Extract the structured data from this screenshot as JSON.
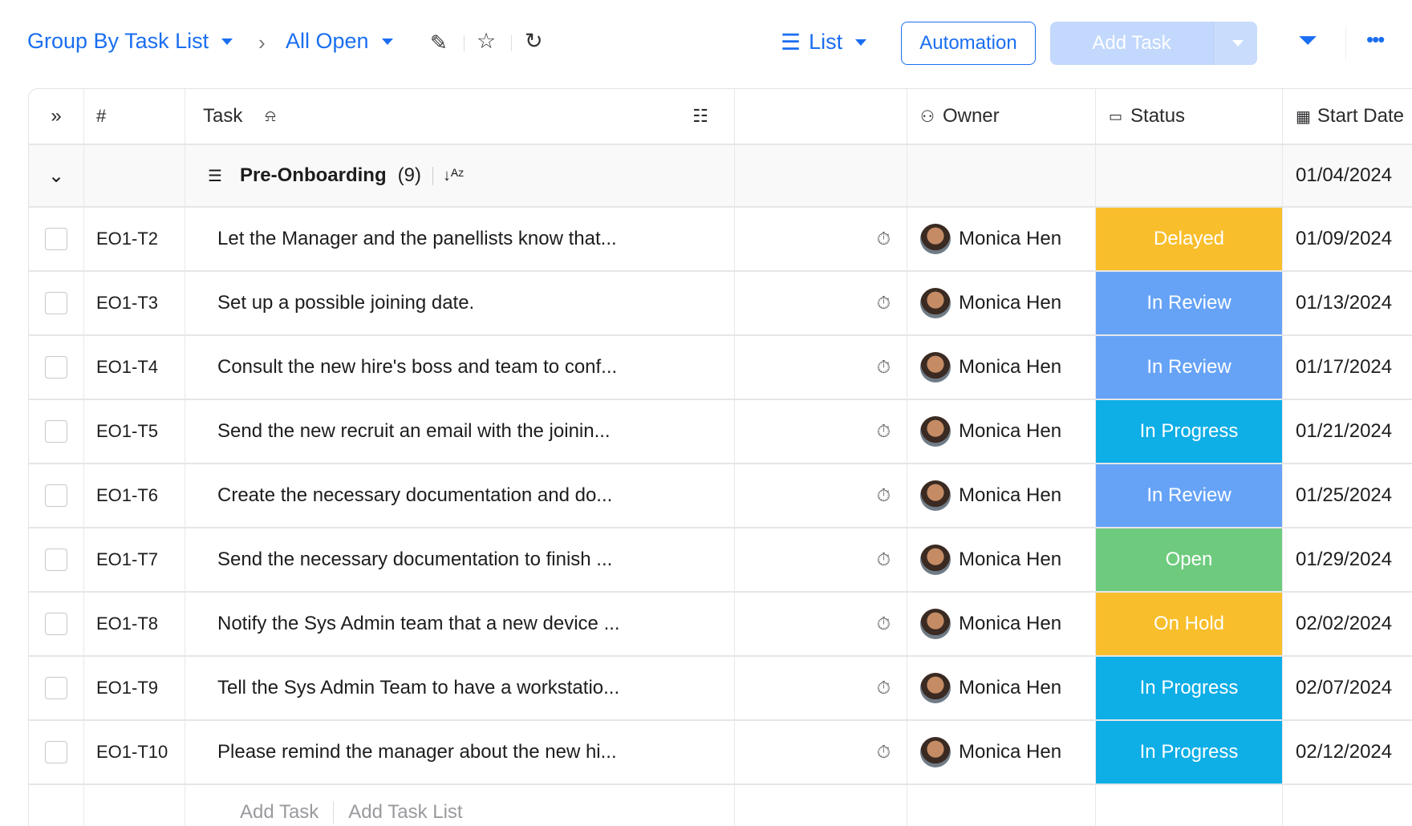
{
  "toolbar": {
    "group_by": "Group By Task List",
    "view_filter": "All Open",
    "view_mode": "List",
    "automation": "Automation",
    "add_task": "Add Task"
  },
  "columns": {
    "hash": "#",
    "task": "Task",
    "owner": "Owner",
    "status": "Status",
    "start_date": "Start Date"
  },
  "group": {
    "name": "Pre-Onboarding",
    "count": "(9)",
    "start_date": "01/04/2024"
  },
  "rows": [
    {
      "id": "EO1-T2",
      "task": "Let the Manager and the panellists know that...",
      "owner": "Monica Hen",
      "status": "Delayed",
      "color": "#f9be2b",
      "start": "01/09/2024"
    },
    {
      "id": "EO1-T3",
      "task": "Set up a possible joining date.",
      "owner": "Monica Hen",
      "status": "In Review",
      "color": "#66a3f7",
      "start": "01/13/2024"
    },
    {
      "id": "EO1-T4",
      "task": "Consult the new hire's boss and team to conf...",
      "owner": "Monica Hen",
      "status": "In Review",
      "color": "#66a3f7",
      "start": "01/17/2024"
    },
    {
      "id": "EO1-T5",
      "task": "Send the new recruit an email with the joinin...",
      "owner": "Monica Hen",
      "status": "In Progress",
      "color": "#0eaee6",
      "start": "01/21/2024"
    },
    {
      "id": "EO1-T6",
      "task": "Create the necessary documentation and do...",
      "owner": "Monica Hen",
      "status": "In Review",
      "color": "#66a3f7",
      "start": "01/25/2024"
    },
    {
      "id": "EO1-T7",
      "task": "Send the necessary documentation to finish ...",
      "owner": "Monica Hen",
      "status": "Open",
      "color": "#6ecb7e",
      "start": "01/29/2024"
    },
    {
      "id": "EO1-T8",
      "task": "Notify the Sys Admin team that a new device ...",
      "owner": "Monica Hen",
      "status": "On Hold",
      "color": "#f9be2b",
      "start": "02/02/2024"
    },
    {
      "id": "EO1-T9",
      "task": "Tell the Sys Admin Team to have a workstatio...",
      "owner": "Monica Hen",
      "status": "In Progress",
      "color": "#0eaee6",
      "start": "02/07/2024"
    },
    {
      "id": "EO1-T10",
      "task": "Please remind the manager about the new hi...",
      "owner": "Monica Hen",
      "status": "In Progress",
      "color": "#0eaee6",
      "start": "02/12/2024"
    }
  ],
  "footer": {
    "add_task": "Add Task",
    "add_task_list": "Add Task List"
  }
}
